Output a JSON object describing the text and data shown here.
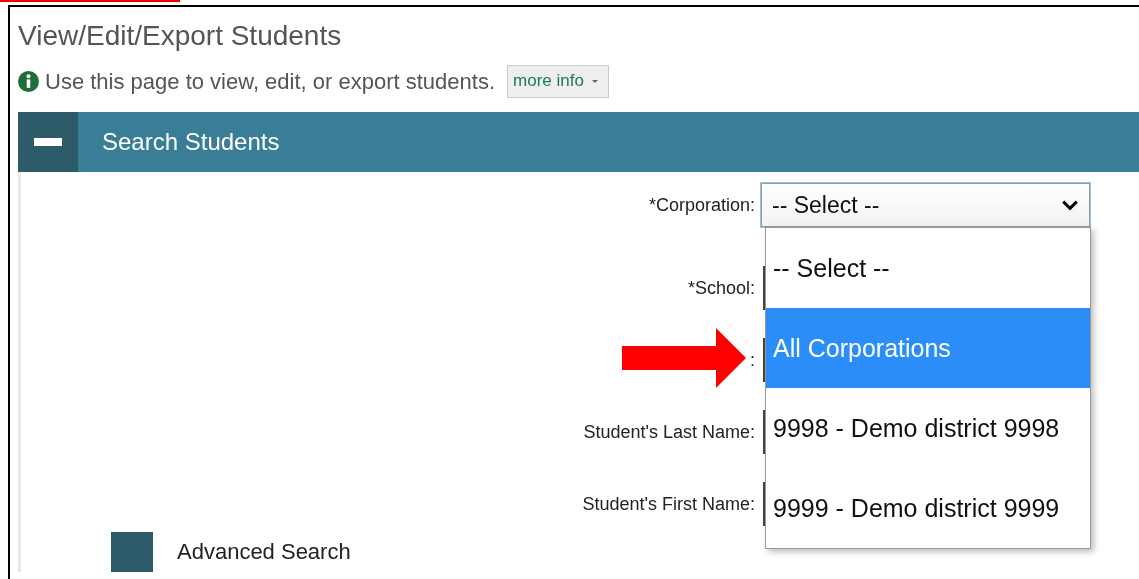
{
  "page": {
    "title": "View/Edit/Export Students",
    "info": "Use this page to view, edit, or export students.",
    "more_info_button": "more info"
  },
  "search_panel": {
    "title": "Search Students",
    "expanded": true,
    "fields": [
      {
        "label": "*Corporation:",
        "value": "-- Select --",
        "open": true
      },
      {
        "label": "*School:"
      },
      {
        "label": ":"
      },
      {
        "label": "Student's Last Name:"
      },
      {
        "label": "Student's First Name:"
      }
    ],
    "dropdown_options": [
      {
        "label": "-- Select --",
        "selected": false
      },
      {
        "label": "All Corporations",
        "selected": true
      },
      {
        "label": "9998 - Demo district 9998",
        "selected": false
      },
      {
        "label": "9999 - Demo district 9999",
        "selected": false
      }
    ],
    "advanced_search": {
      "label": "Advanced Search"
    }
  }
}
